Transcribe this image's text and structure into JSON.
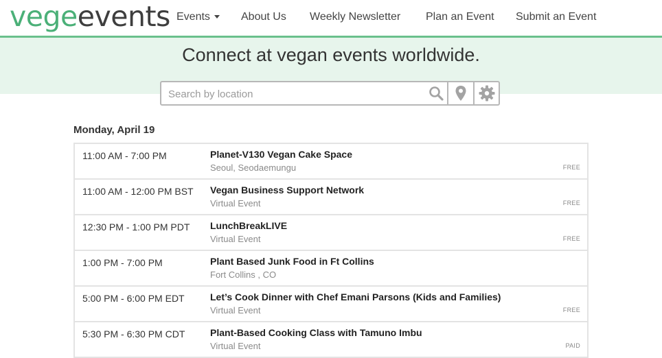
{
  "logo": {
    "part1": "vege",
    "part2": "events"
  },
  "nav": {
    "events": "Events",
    "about": "About Us",
    "newsletter": "Weekly Newsletter",
    "plan": "Plan an Event",
    "submit": "Submit an Event"
  },
  "hero": {
    "title": "Connect at vegan events worldwide."
  },
  "search": {
    "placeholder": "Search by location",
    "value": ""
  },
  "date_heading": "Monday, April 19",
  "events": [
    {
      "time": "11:00 AM - 7:00 PM",
      "title": "Planet-V130 Vegan Cake Space",
      "location": "Seoul, Seodaemungu",
      "price": "FREE"
    },
    {
      "time": "11:00 AM - 12:00 PM BST",
      "title": "Vegan Business Support Network",
      "location": "Virtual Event",
      "price": "FREE"
    },
    {
      "time": "12:30 PM - 1:00 PM PDT",
      "title": "LunchBreakLIVE",
      "location": "Virtual Event",
      "price": "FREE"
    },
    {
      "time": "1:00 PM - 7:00 PM",
      "title": "Plant Based Junk Food in Ft Collins",
      "location": "Fort Collins , CO",
      "price": ""
    },
    {
      "time": "5:00 PM - 6:00 PM EDT",
      "title": "Let’s Cook Dinner with Chef Emani Parsons (Kids and Families)",
      "location": "Virtual Event",
      "price": "FREE"
    },
    {
      "time": "5:30 PM - 6:30 PM CDT",
      "title": "Plant-Based Cooking Class with Tamuno Imbu",
      "location": "Virtual Event",
      "price": "PAID"
    }
  ],
  "icons": {
    "search": "search-icon",
    "location": "map-pin-icon",
    "settings": "gear-icon"
  },
  "colors": {
    "brand_green": "#4bb078",
    "hero_bg": "#e7f5ec",
    "text_dark": "#3e3e3e"
  }
}
